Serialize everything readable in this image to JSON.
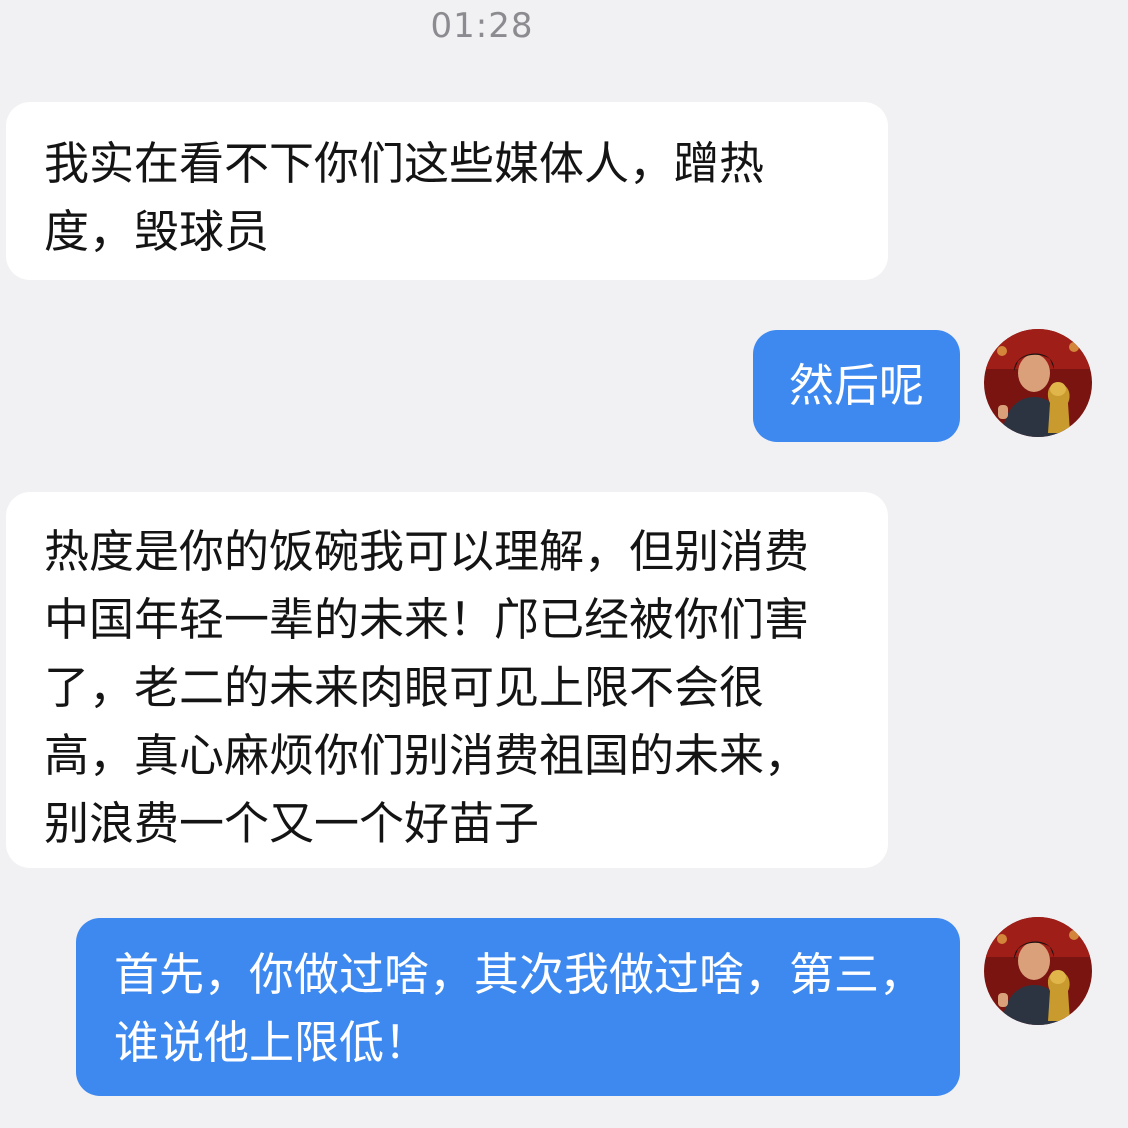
{
  "chat": {
    "timestamp": "01:28",
    "messages": [
      {
        "direction": "incoming",
        "text": "我实在看不下你们这些媒体人，蹭热度，毁球员"
      },
      {
        "direction": "outgoing",
        "text": "然后呢"
      },
      {
        "direction": "incoming",
        "text": "热度是你的饭碗我可以理解，但别消费中国年轻一辈的未来！邝已经被你们害了，老二的未来肉眼可见上限不会很高，真心麻烦你们别消费祖国的未来，别浪费一个又一个好苗子"
      },
      {
        "direction": "outgoing",
        "text": "首先，你做过啥，其次我做过啥，第三，谁说他上限低！"
      }
    ]
  },
  "colors": {
    "background": "#f1f1f3",
    "incoming_bubble": "#ffffff",
    "outgoing_bubble": "#3e89f0",
    "timestamp_text": "#8b8b90"
  },
  "icons": {
    "avatar": "user-avatar-with-trophy"
  }
}
